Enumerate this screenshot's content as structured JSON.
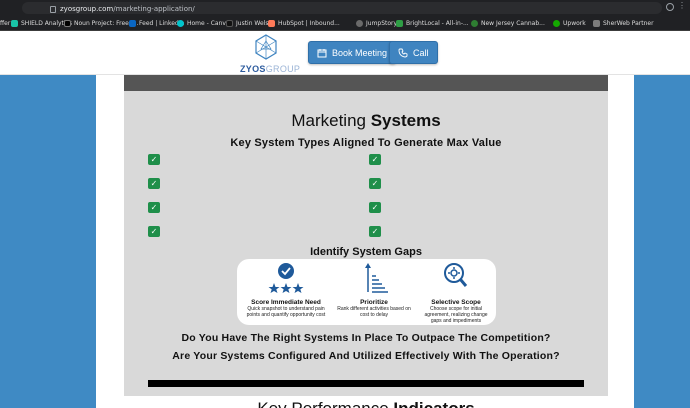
{
  "browser": {
    "url_domain": "zyosgroup.com",
    "url_path": "/marketing-application/",
    "bookmarks": [
      {
        "label": "ffer",
        "color": "#202124"
      },
      {
        "label": "SHIELD Analytics",
        "color": "#19c3a6"
      },
      {
        "label": "Noun Project: Free I...",
        "color": "#000000"
      },
      {
        "label": "Feed | LinkedIn",
        "color": "#0a66c2"
      },
      {
        "label": "Home - Canva",
        "color": "#00c4cc"
      },
      {
        "label": "Justin Welsh",
        "color": "#111111"
      },
      {
        "label": "HubSpot | Inbound...",
        "color": "#ff7a59"
      },
      {
        "label": "JumpStory",
        "color": "#6a6a6a"
      },
      {
        "label": "BrightLocal - All-in-...",
        "color": "#2e9e45"
      },
      {
        "label": "New Jersey Cannab...",
        "color": "#2e7d32"
      },
      {
        "label": "Upwork",
        "color": "#14a800"
      },
      {
        "label": "SherWeb Partner",
        "color": "#7c7c7c"
      }
    ]
  },
  "header": {
    "logo_bold": "ZYOS",
    "logo_light": "GROUP",
    "book_label": "Book Meeting",
    "call_label": "Call"
  },
  "section": {
    "title_plain": "Marketing ",
    "title_bold": "Systems",
    "subtitle": "Key System Types Aligned To Generate Max Value",
    "gaps_title": "Identify System Gaps",
    "features": [
      {
        "title": "Score Immediate Need",
        "desc": "Quick snapshot to understand pain points and quantify opportunity cost"
      },
      {
        "title": "Prioritize",
        "desc": "Rank different activities based on cost to delay"
      },
      {
        "title": "Selective Scope",
        "desc": "Choose scope for initial agreement, realizing change gaps and impediments"
      }
    ],
    "question_1": "Do You Have The Right Systems In Place To Outpace The Competition?",
    "question_2": "Are Your Systems Configured And Utilized Effectively With The Operation?",
    "check_glyph": "✓"
  },
  "kpi": {
    "title_plain": "Key Performance ",
    "title_bold": "Indicators"
  },
  "colors": {
    "page_bg": "#3f8ac4",
    "accent_button": "#3f84c0",
    "check_green": "#1f8f4a",
    "icon_blue": "#1f5a9a"
  }
}
